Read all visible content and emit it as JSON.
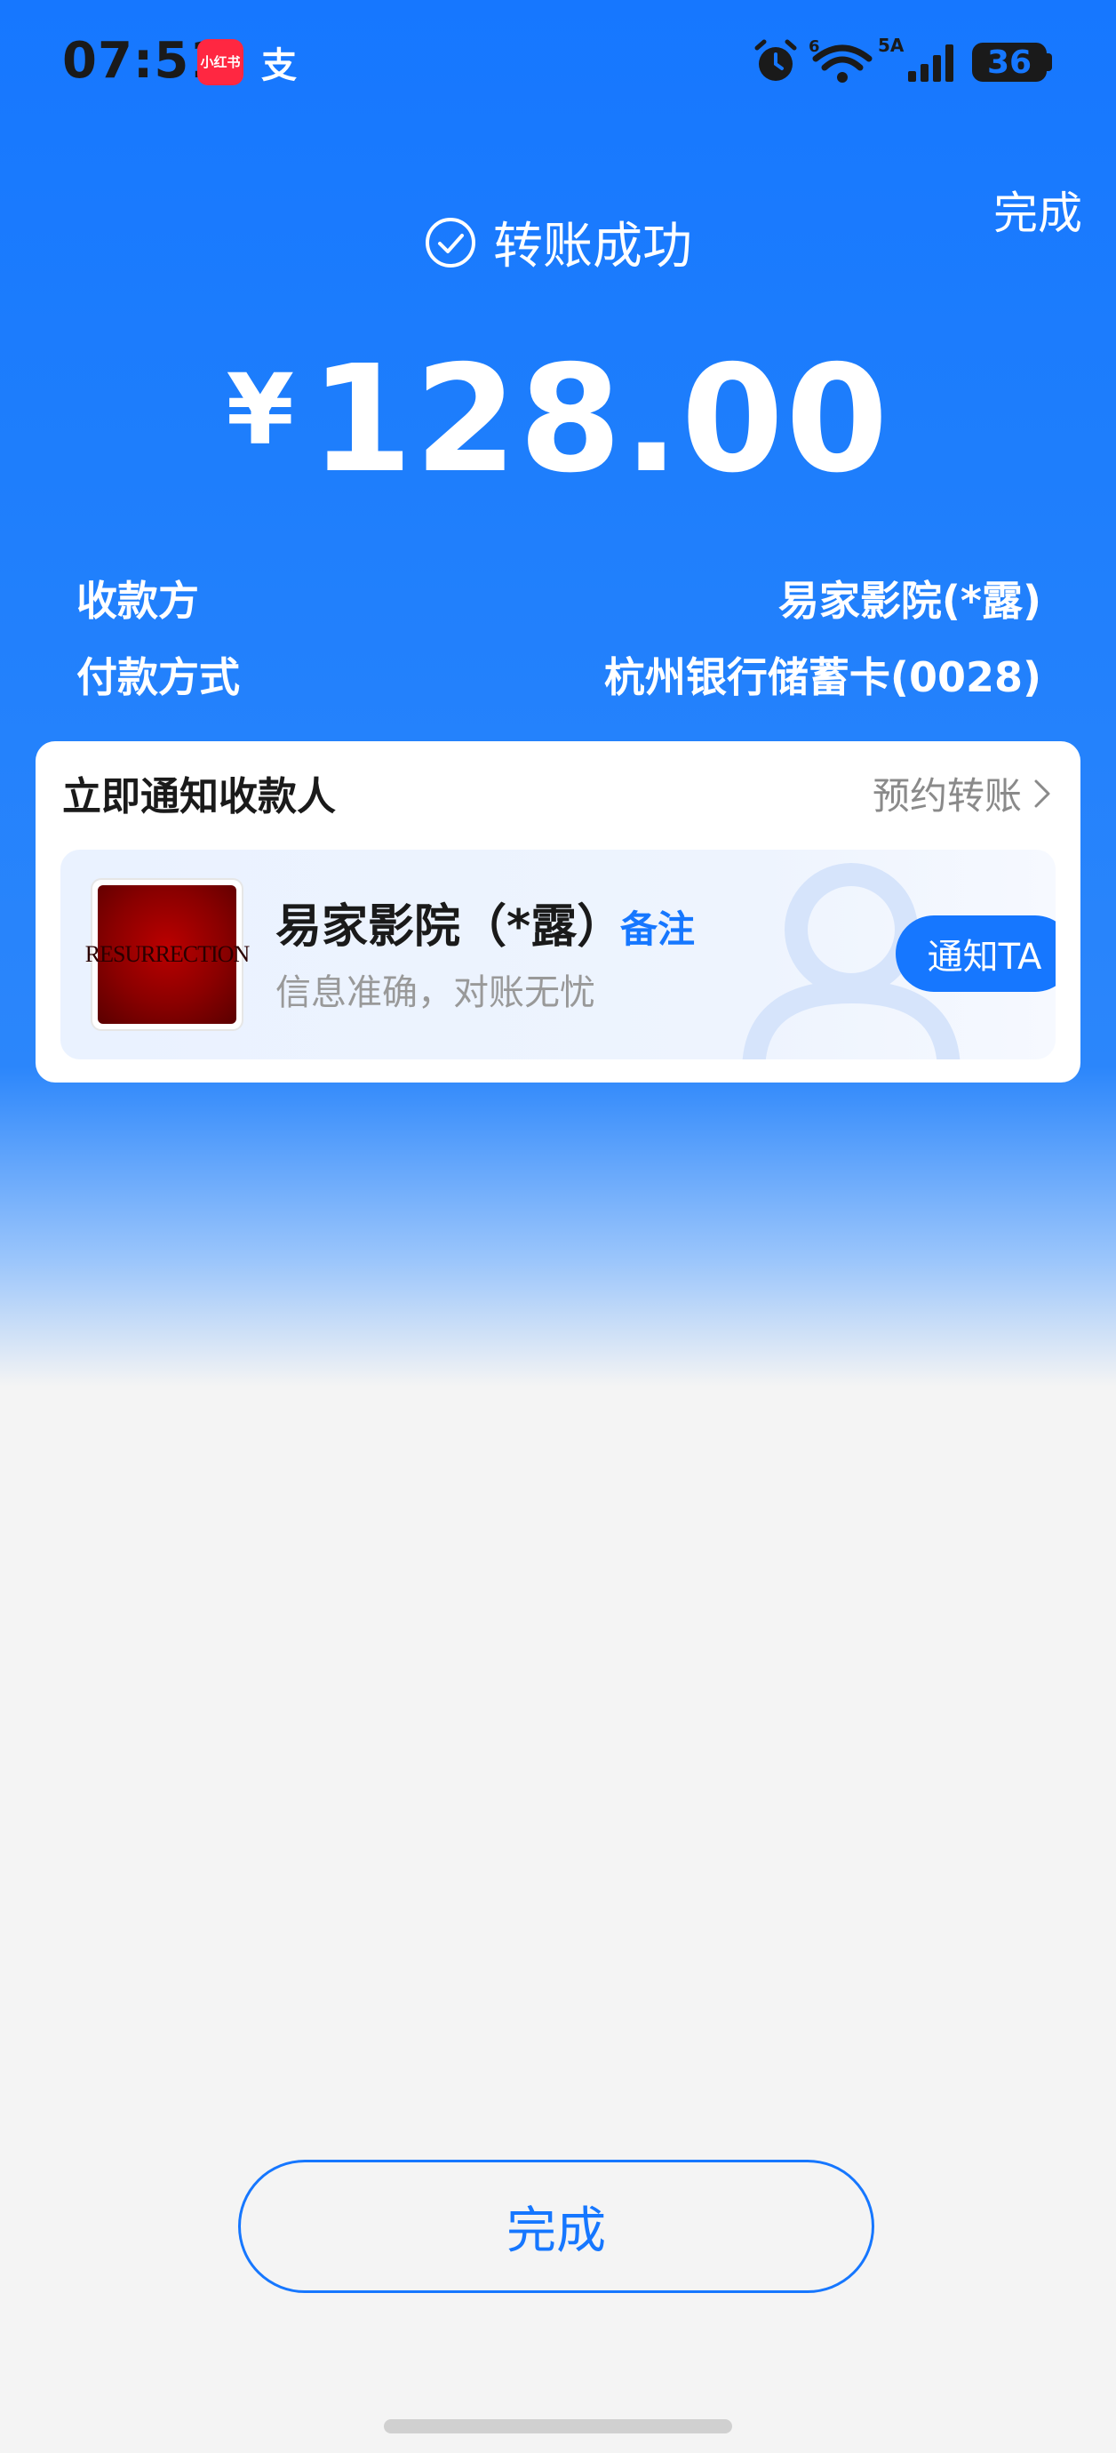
{
  "status_bar": {
    "time": "07:51",
    "app_badge": "小红书",
    "alipay_badge": "支",
    "wifi_label": "6",
    "network_label": "5A",
    "battery": "36"
  },
  "header": {
    "done_label": "完成",
    "status_text": "转账成功",
    "currency": "¥",
    "amount": "128.00"
  },
  "info": {
    "payee_label": "收款方",
    "payee_value": "易家影院(*露)",
    "method_label": "付款方式",
    "method_value": "杭州银行储蓄卡(0028)"
  },
  "card": {
    "title": "立即通知收款人",
    "schedule_label": "预约转账",
    "avatar_text": "RESURRECTION",
    "payee_name": "易家影院（*露）",
    "remark_label": "备注",
    "subtitle": "信息准确，对账无忧",
    "notify_label": "通知TA"
  },
  "footer": {
    "done_label": "完成"
  },
  "colors": {
    "accent": "#1677ff",
    "background": "#f4f4f4",
    "text": "#1a1a1a"
  }
}
